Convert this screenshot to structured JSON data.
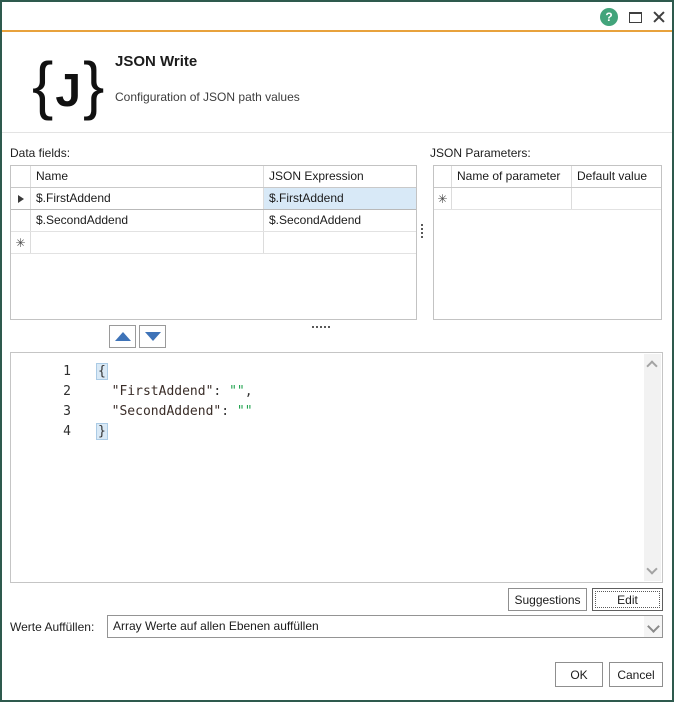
{
  "titlebar": {
    "help_glyph": "?"
  },
  "header": {
    "icon_open": "{",
    "icon_letter": "J",
    "icon_close": "}",
    "title": "JSON Write",
    "subtitle": "Configuration of JSON path values"
  },
  "data_fields": {
    "label": "Data fields:",
    "columns": {
      "name": "Name",
      "expression": "JSON Expression"
    },
    "rows": [
      {
        "name": "$.FirstAddend",
        "expression": "$.FirstAddend"
      },
      {
        "name": "$.SecondAddend",
        "expression": "$.SecondAddend"
      },
      {
        "name": "",
        "expression": ""
      }
    ],
    "new_row_marker": "✳"
  },
  "json_parameters": {
    "label": "JSON Parameters:",
    "columns": {
      "name": "Name of parameter",
      "value": "Default value"
    },
    "new_row_marker": "✳"
  },
  "editor": {
    "lines": [
      {
        "num": "1",
        "brace": "{"
      },
      {
        "num": "2",
        "indent": "  ",
        "key": "\"FirstAddend\"",
        "sep": ": ",
        "value": "\"\"",
        "comma": ","
      },
      {
        "num": "3",
        "indent": "  ",
        "key": "\"SecondAddend\"",
        "sep": ": ",
        "value": "\"\""
      },
      {
        "num": "4",
        "brace": "}"
      }
    ]
  },
  "actions": {
    "suggestions": "Suggestions",
    "edit": "Edit",
    "ok": "OK",
    "cancel": "Cancel"
  },
  "fill_values": {
    "label": "Werte Auffüllen:",
    "selected": "Array Werte auf allen Ebenen auffüllen"
  },
  "colors": {
    "window_border": "#2e5a4e",
    "accent_line": "#e8a23c",
    "help_green": "#42a47b",
    "selection_blue": "#d8e9f7",
    "arrow_blue": "#3e73b8",
    "string_green": "#21a34f"
  }
}
